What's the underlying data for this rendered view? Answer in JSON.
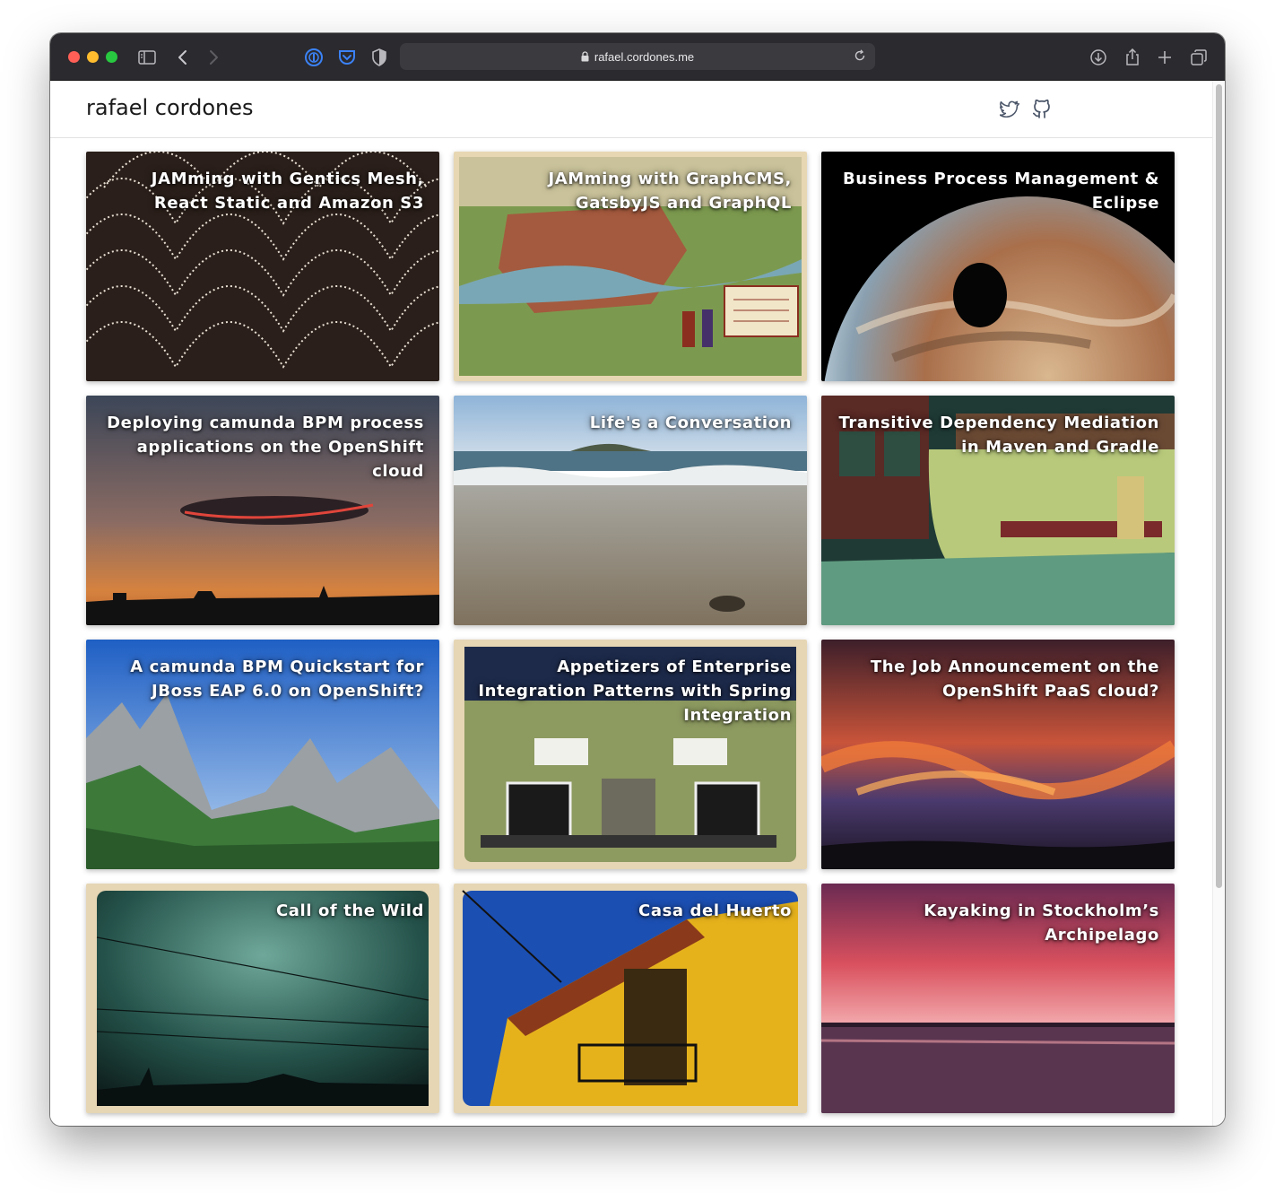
{
  "browser": {
    "url": "rafael.cordones.me"
  },
  "site": {
    "title": "rafael cordones",
    "social_icons": [
      "twitter-icon",
      "github-icon"
    ]
  },
  "posts": [
    {
      "title": "JAMming with Gentics Mesh, React Static and Amazon S3"
    },
    {
      "title": "JAMming with GraphCMS, GatsbyJS and GraphQL"
    },
    {
      "title": "Business Process Management & Eclipse"
    },
    {
      "title": "Deploying camunda BPM process applications on the OpenShift cloud"
    },
    {
      "title": "Life's a Conversation"
    },
    {
      "title": "Transitive Dependency Mediation in Maven and Gradle"
    },
    {
      "title": "A camunda BPM Quickstart for JBoss EAP 6.0 on OpenShift?"
    },
    {
      "title": "Appetizers of Enterprise Integration Patterns with Spring Integration"
    },
    {
      "title": "The Job Announcement on the OpenShift PaaS cloud?"
    },
    {
      "title": "Call of the Wild"
    },
    {
      "title": "Casa del Huerto"
    },
    {
      "title": "Kayaking in Stockholm’s Archipelago"
    }
  ]
}
